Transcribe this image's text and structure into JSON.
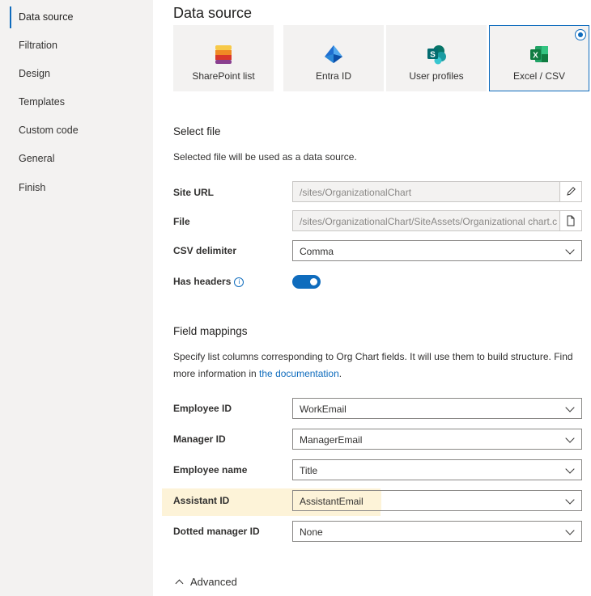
{
  "sidebar": {
    "items": [
      {
        "label": "Data source",
        "active": true
      },
      {
        "label": "Filtration"
      },
      {
        "label": "Design"
      },
      {
        "label": "Templates"
      },
      {
        "label": "Custom code"
      },
      {
        "label": "General"
      },
      {
        "label": "Finish"
      }
    ]
  },
  "page_title": "Data source",
  "sources": [
    {
      "label": "SharePoint list",
      "icon": "sharepoint-list-icon"
    },
    {
      "label": "Entra ID",
      "icon": "entra-id-icon"
    },
    {
      "label": "User profiles",
      "icon": "sharepoint-icon"
    },
    {
      "label": "Excel / CSV",
      "icon": "excel-icon",
      "selected": true
    }
  ],
  "select_file": {
    "title": "Select file",
    "description": "Selected file will be used as a data source.",
    "site_url_label": "Site URL",
    "site_url_value": "/sites/OrganizationalChart",
    "file_label": "File",
    "file_value": "/sites/OrganizationalChart/SiteAssets/Organizational chart.csv",
    "delimiter_label": "CSV delimiter",
    "delimiter_value": "Comma",
    "headers_label": "Has headers",
    "has_headers": true
  },
  "field_mappings": {
    "title": "Field mappings",
    "description_line1": "Specify list columns corresponding to Org Chart fields. It will use them to build structure. Find",
    "description_prefix": "more information in ",
    "description_link": "the documentation",
    "description_suffix": ".",
    "fields": [
      {
        "label": "Employee ID",
        "value": "WorkEmail"
      },
      {
        "label": "Manager ID",
        "value": "ManagerEmail"
      },
      {
        "label": "Employee name",
        "value": "Title"
      },
      {
        "label": "Assistant ID",
        "value": "AssistantEmail",
        "highlighted": true
      },
      {
        "label": "Dotted manager ID",
        "value": "None"
      }
    ]
  },
  "advanced_label": "Advanced",
  "colors": {
    "accent": "#0f6cbd",
    "highlight": "#fdf3d8",
    "sidebar_bg": "#f3f2f1"
  }
}
